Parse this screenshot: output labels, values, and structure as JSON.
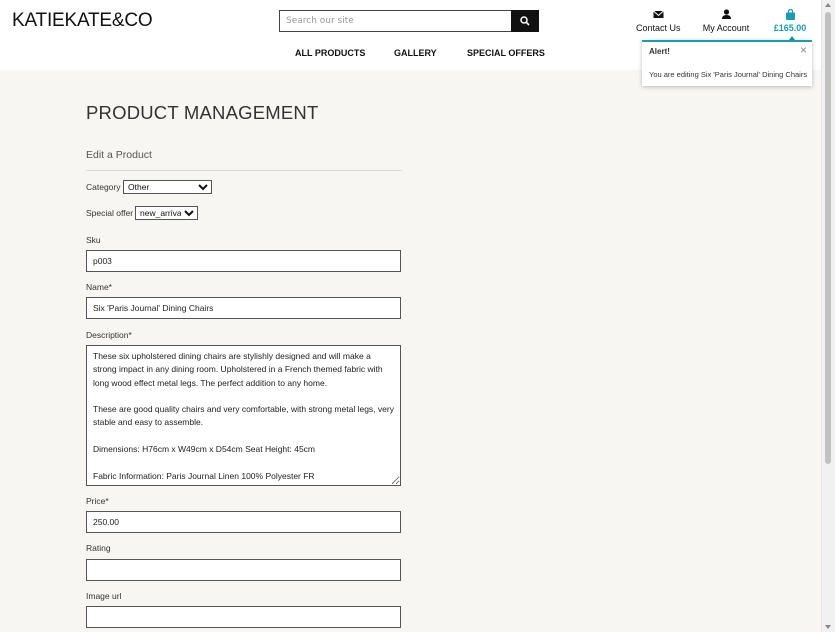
{
  "header": {
    "logo": "KATIEKATE&CO",
    "search_placeholder": "Search our site",
    "nav": [
      "ALL PRODUCTS",
      "GALLERY",
      "SPECIAL OFFERS"
    ],
    "contact_label": "Contact Us",
    "account_label": "My Account",
    "bag_total": "£165.00",
    "accent_color": "#1a9ab5",
    "icons": [
      "search-icon",
      "envelope-icon",
      "user-icon",
      "shopping-bag-icon"
    ]
  },
  "alert": {
    "title": "Alert!",
    "message": "You are editing Six 'Paris Journal' Dining Chairs",
    "close": "×"
  },
  "main": {
    "page_title": "PRODUCT MANAGEMENT",
    "subtitle": "Edit a Product",
    "form": {
      "category_label": "Category",
      "category_value": "Other",
      "special_offer_label": "Special offer",
      "special_offer_value": "new_arrivals",
      "sku_label": "Sku",
      "sku_value": "p003",
      "name_label": "Name*",
      "name_value": "Six 'Paris Journal' Dining Chairs",
      "description_label": "Description*",
      "description_value": "These six upholstered dining chairs are stylishly designed and will make a strong impact in any dining room. Upholstered in a French themed fabric with long wood effect metal legs. The perfect addition to any home.\n\nThese are good quality chairs and very comfortable, with strong metal legs, very stable and easy to assemble.\n\nDimensions: H76cm x W49cm x D54cm Seat Height: 45cm\n\nFabric Information: Paris Journal Linen 100% Polyester FR",
      "price_label": "Price*",
      "price_value": "250.00",
      "rating_label": "Rating",
      "rating_value": "",
      "image_url_label": "Image url",
      "image_url_value": ""
    }
  }
}
